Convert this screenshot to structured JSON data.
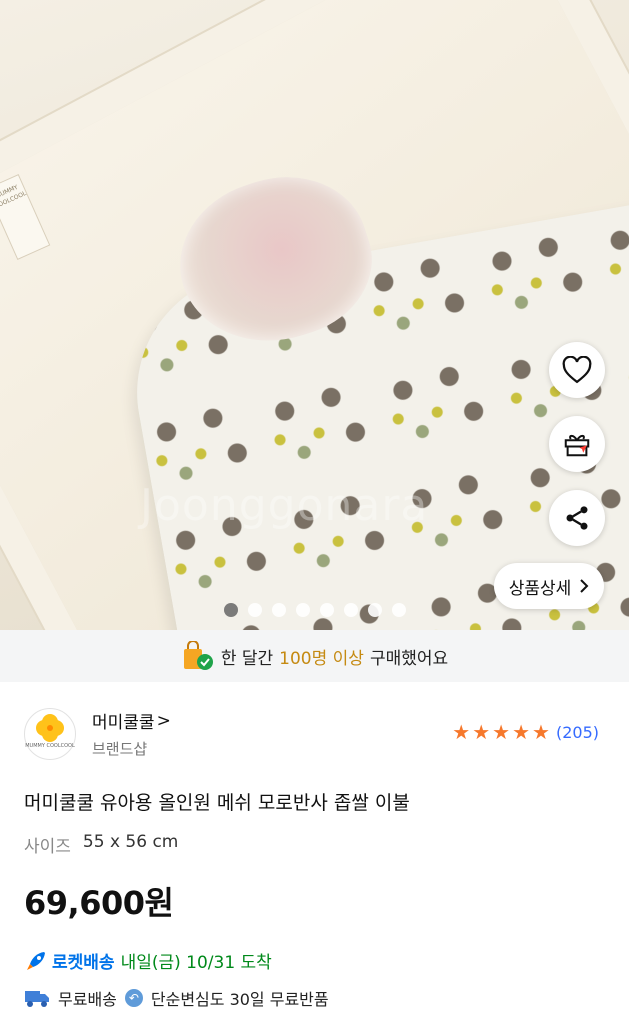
{
  "hero": {
    "mat_label": "MUMMY COOLCOOL",
    "watermark": "Joonggonara",
    "detail_button_label": "상품상세",
    "carousel": {
      "total": 8,
      "active_index": 0
    }
  },
  "promo": {
    "prefix": "한 달간 ",
    "highlight": "100명 이상",
    "suffix": " 구매했어요"
  },
  "brand": {
    "logo_text": "MUMMY COOLCOOL",
    "name": "머미쿨쿨",
    "chevron": ">",
    "sub": "브랜드샵"
  },
  "rating": {
    "stars": 5,
    "count": "(205)"
  },
  "product": {
    "title": "머미쿨쿨 유아용 올인원 메쉬 모로반사 좁쌀 이불",
    "size_key": "사이즈",
    "size_value": "55 x 56 cm",
    "price": "69,600원"
  },
  "delivery": {
    "rocket_label": "로켓배송",
    "arrival": "내일(금) 10/31 도착",
    "free_shipping": "무료배송",
    "return_policy": "단순변심도 30일 무료반품"
  },
  "colors": {
    "rocket_blue": "#0073e9",
    "arrival_green": "#00891a",
    "rating_blue": "#346aff",
    "star_orange": "#f6782c"
  },
  "icons": [
    "heart-icon",
    "gift-icon",
    "share-icon",
    "chevron-right-icon",
    "shopping-bag-icon",
    "rocket-icon",
    "truck-icon",
    "return-icon"
  ]
}
